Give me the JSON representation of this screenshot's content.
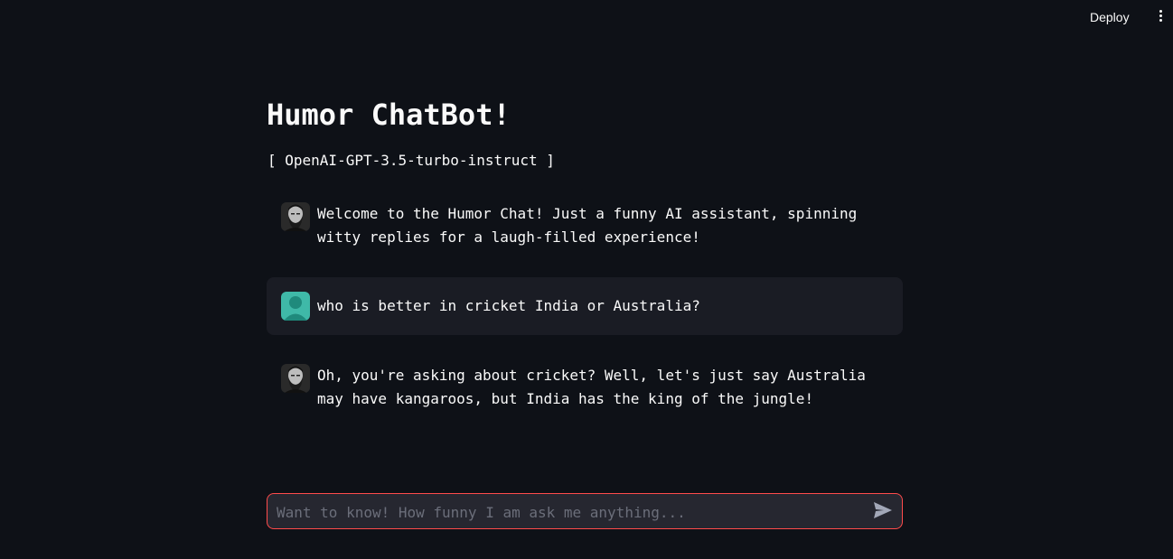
{
  "toolbar": {
    "deploy_label": "Deploy",
    "menu_icon": "vertical-dots-icon"
  },
  "header": {
    "title": "Humor ChatBot!",
    "subtitle": "[ OpenAI-GPT-3.5-turbo-instruct ]"
  },
  "messages": [
    {
      "role": "assistant",
      "avatar": "bearded-man-avatar",
      "text": "Welcome to the Humor Chat! Just a funny AI assistant, spinning witty replies for a laugh-filled experience!"
    },
    {
      "role": "user",
      "avatar": "user-avatar",
      "text": "who is better in cricket India or Australia?"
    },
    {
      "role": "assistant",
      "avatar": "bearded-man-avatar",
      "text": "Oh, you're asking about cricket? Well, let's just say Australia may have kangaroos, but India has the king of the jungle!"
    }
  ],
  "chat_input": {
    "placeholder": "Want to know! How funny I am ask me anything...",
    "value": "",
    "send_icon": "send-icon"
  },
  "colors": {
    "background": "#0e1117",
    "user_bubble": "#1a1c24",
    "input_background": "#262730",
    "input_border": "#ff4b4b",
    "user_avatar": "#3fb9a8"
  }
}
